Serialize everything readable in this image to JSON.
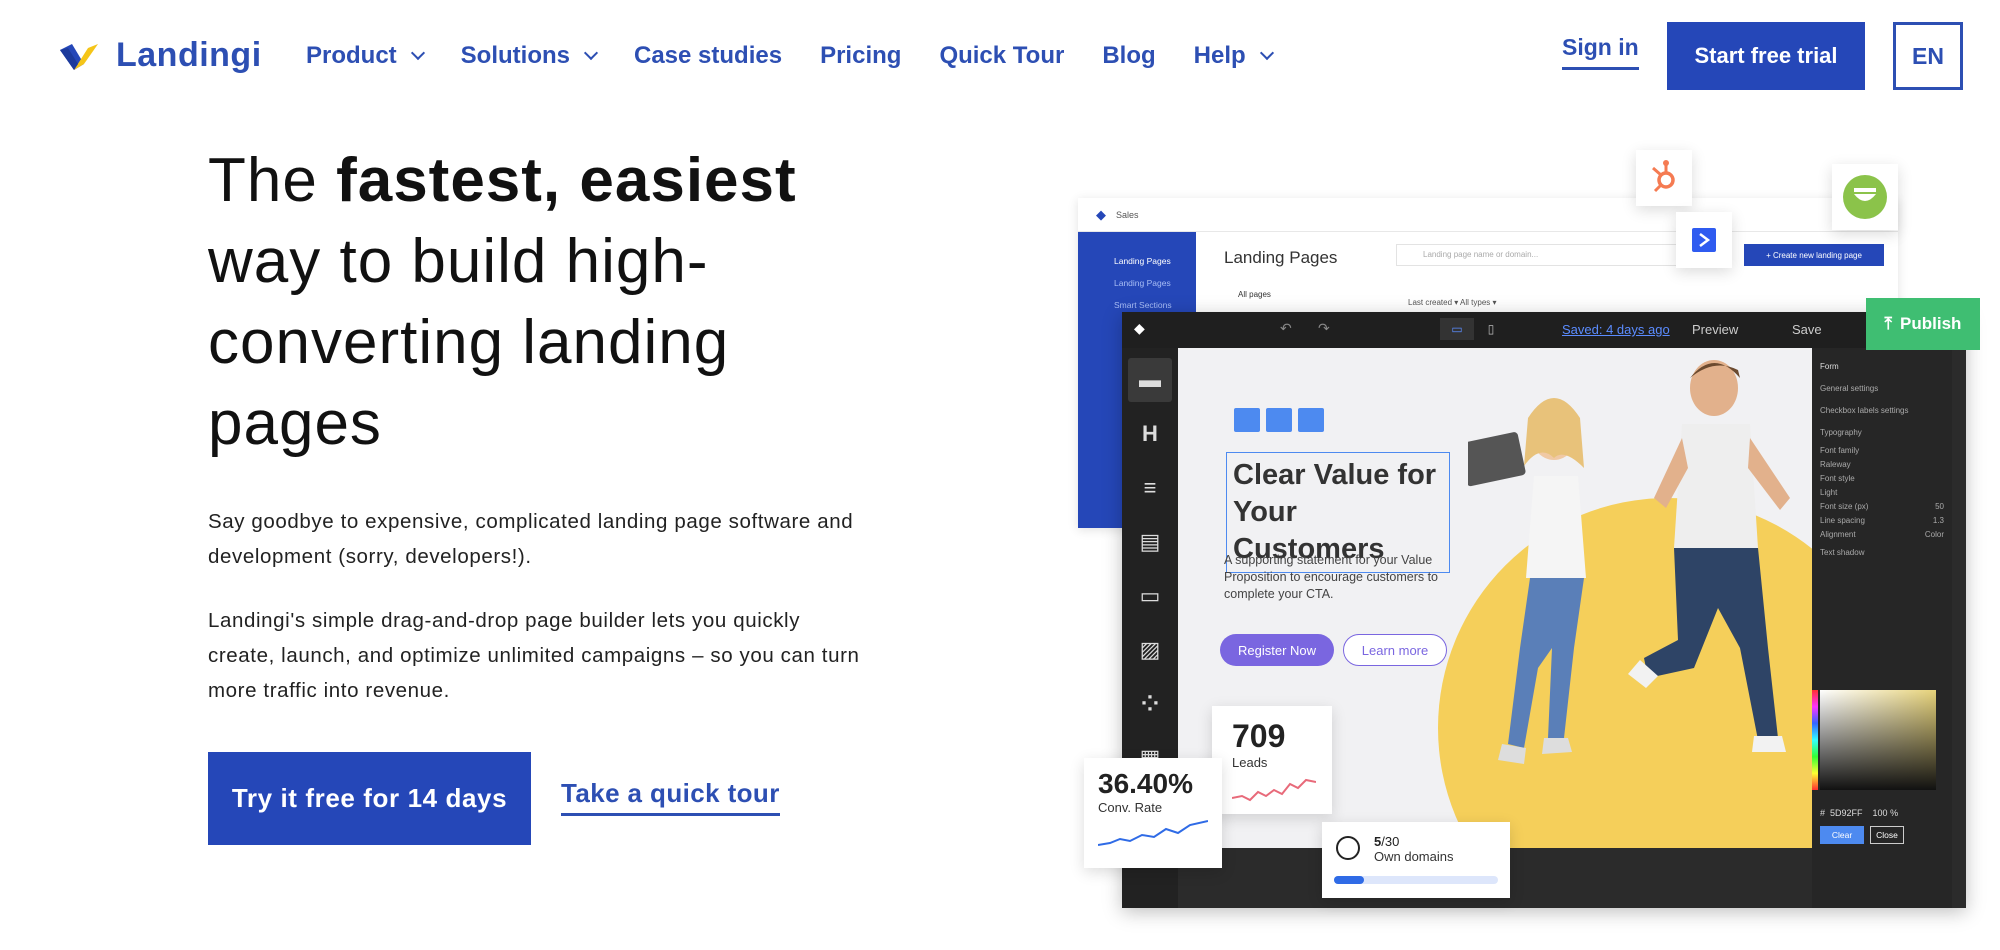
{
  "brand": {
    "name": "Landingi"
  },
  "nav": {
    "items": [
      {
        "label": "Product",
        "dropdown": true
      },
      {
        "label": "Solutions",
        "dropdown": true
      },
      {
        "label": "Case studies",
        "dropdown": false
      },
      {
        "label": "Pricing",
        "dropdown": false
      },
      {
        "label": "Quick Tour",
        "dropdown": false
      },
      {
        "label": "Blog",
        "dropdown": false
      },
      {
        "label": "Help",
        "dropdown": true
      }
    ],
    "signin": "Sign in",
    "trial": "Start free trial",
    "language": "EN"
  },
  "hero": {
    "headline_pre": "The ",
    "headline_bold": "fastest, easiest",
    "headline_post": " way to build high-converting landing pages",
    "para1": "Say goodbye to expensive, complicated landing page software and development (sorry, developers!).",
    "para2": "Landingi's simple drag-and-drop page builder lets you quickly create, launch, and optimize unlimited campaigns – so you can turn more traffic into revenue.",
    "cta_primary": "Try it free for 14 days",
    "cta_secondary": "Take a quick tour"
  },
  "mockup": {
    "back": {
      "workspace": "Sales",
      "title": "Landing Pages",
      "search_placeholder": "Landing page name or domain...",
      "create": "+ Create new landing page",
      "all_pages": "All pages",
      "filters": "Last created  ▾     All types  ▾",
      "sidebar": [
        "Landing Pages"
      ],
      "sidebar_sub": [
        "Landing Pages",
        "Smart Sections"
      ]
    },
    "editor": {
      "saved": "Saved: 4 days ago",
      "preview": "Preview",
      "save": "Save",
      "publish": "Publish",
      "canvas_title": "Clear Value for Your Customers",
      "canvas_sub": "A supporting statement for your Value Proposition to encourage customers to complete your CTA.",
      "register": "Register Now",
      "learn": "Learn more",
      "panel": {
        "head": "Form",
        "items": [
          "General settings",
          "Checkbox labels settings",
          "Typography",
          "Font family",
          "Raleway",
          "Font style",
          "Light",
          "Font size (px)",
          "Line spacing",
          "Alignment",
          "Text shadow"
        ],
        "font_size": "50",
        "line_spacing": "1.3",
        "color_label": "Color",
        "hex": "5D92FF",
        "opacity": "100",
        "clear": "Clear",
        "close": "Close"
      }
    },
    "stats": {
      "leads_value": "709",
      "leads_label": "Leads",
      "conv_value": "36.40%",
      "conv_label": "Conv. Rate",
      "domains_used": "5",
      "domains_total": "/30",
      "domains_label": "Own domains",
      "domains_progress": 0.18
    },
    "colors": {
      "accent": "#2547b8",
      "publish": "#3fbe72",
      "yellow": "#f5cf5a",
      "purple": "#7a66e0"
    }
  }
}
